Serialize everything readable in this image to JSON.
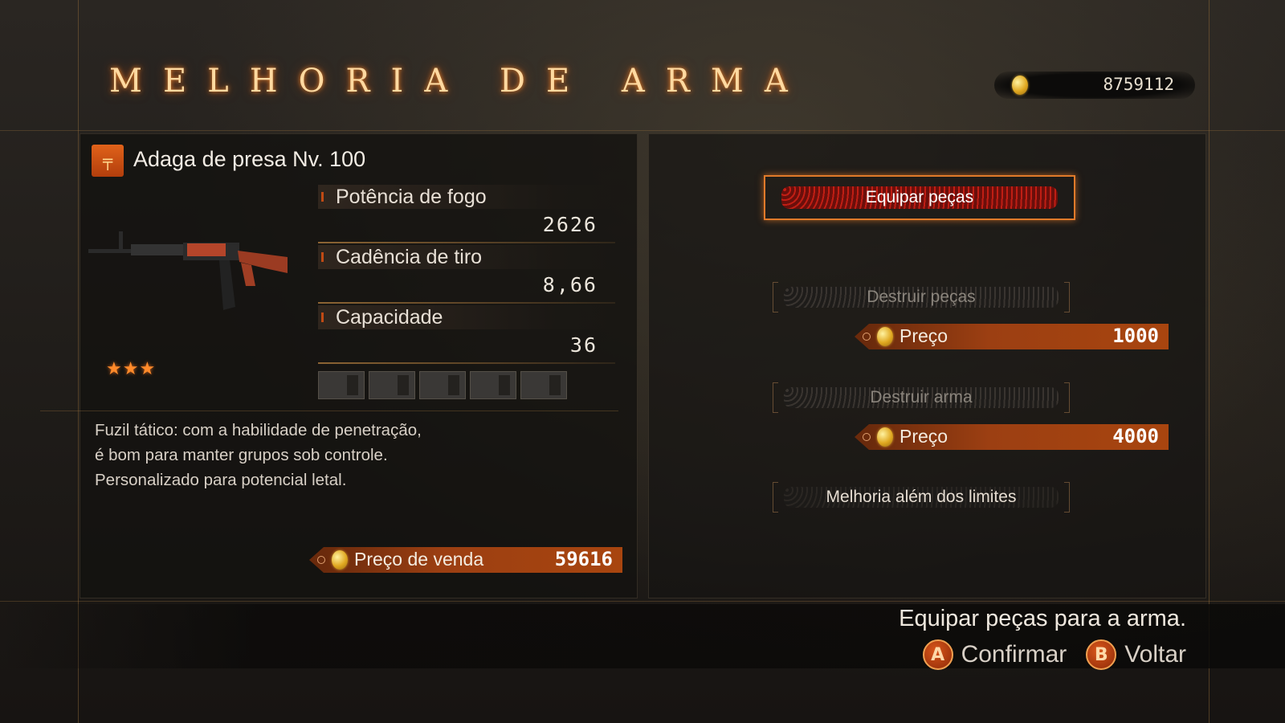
{
  "header": {
    "title": "MELHORIA DE ARMA",
    "money": "8759112"
  },
  "weapon": {
    "name": "Adaga de presa Nv. 100",
    "rarity_stars": 3,
    "stars_text": "★★★",
    "stats": [
      {
        "label": "Potência de fogo",
        "value": "2626"
      },
      {
        "label": "Cadência de tiro",
        "value": "8,66"
      },
      {
        "label": "Capacidade",
        "value": "36"
      }
    ],
    "part_slots": 5,
    "description": [
      "Fuzil tático: com a habilidade de penetração,",
      "é bom para manter grupos sob controle.",
      "Personalizado para potencial letal."
    ],
    "sale_price_label": "Preço de venda",
    "sale_price": "59616"
  },
  "menu": {
    "equip_parts": "Equipar peças",
    "destroy_parts": "Destruir peças",
    "destroy_parts_price_label": "Preço",
    "destroy_parts_price": "1000",
    "destroy_weapon": "Destruir arma",
    "destroy_weapon_price_label": "Preço",
    "destroy_weapon_price": "4000",
    "beyond_limits": "Melhoria além dos limites"
  },
  "footer": {
    "help": "Equipar peças para a arma.",
    "confirm_key": "A",
    "confirm_label": "Confirmar",
    "back_key": "B",
    "back_label": "Voltar"
  },
  "colors": {
    "accent_orange": "#e07a2a",
    "price_tag": "#9c3f12",
    "active_button": "#c81e14"
  },
  "icons": [
    "coin-icon",
    "rifle-icon",
    "weapon-category-icon",
    "star-icon"
  ]
}
